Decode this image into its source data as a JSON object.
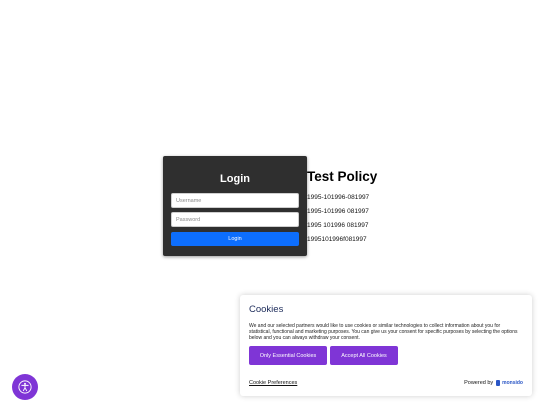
{
  "login": {
    "title": "Login",
    "username_placeholder": "Username",
    "password_placeholder": "Password",
    "button_label": "Login"
  },
  "policy": {
    "title": "Test Policy",
    "lines": [
      "1995-101996-081997",
      "1995-101996 081997",
      "1995 101996 081997",
      "1995101996f081997"
    ]
  },
  "cookies": {
    "title": "Cookies",
    "text": "We and our selected partners would like to use cookies or similar technologies to collect information about you for statistical, functional and marketing purposes. You can give us your consent for specific purposes by selecting the options below and you can always withdraw your consent.",
    "essential_label": "Only Essential Cookies",
    "accept_label": "Accept All Cookies",
    "preferences_label": "Cookie Preferences",
    "powered_by": "Powered by",
    "brand": "monsido"
  },
  "colors": {
    "login_bg": "#2f2f2f",
    "login_button": "#0d6efd",
    "cookie_button": "#7f35d6",
    "cookie_title": "#1c2b5a"
  },
  "icons": {
    "accessibility": "accessibility-icon"
  }
}
